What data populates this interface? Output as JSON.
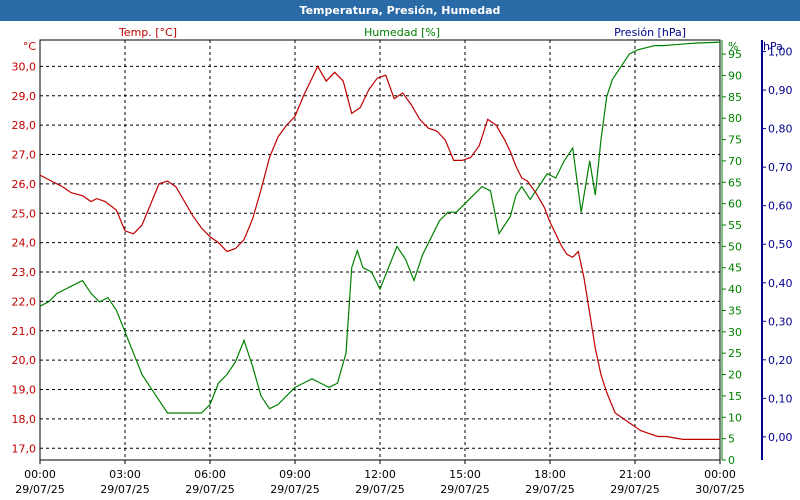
{
  "chart_data": {
    "type": "line",
    "title": "Temperatura, Presión, Humedad",
    "colors": {
      "temperature": "#c00000",
      "humidity": "#008000",
      "pressure": "#00008b",
      "title_bar": "#2a6aa7"
    },
    "series_labels": {
      "temperature": "Temp. [°C]",
      "humidity": "Humedad [%]",
      "pressure": "Presión [hPa]"
    },
    "axes": {
      "left": {
        "unit": "°C",
        "range": [
          16.6,
          30.9
        ],
        "ticks": [
          "17,0",
          "18,0",
          "19,0",
          "20,0",
          "21,0",
          "22,0",
          "23,0",
          "24,0",
          "25,0",
          "26,0",
          "27,0",
          "28,0",
          "29,0",
          "30,0"
        ],
        "tick_values": [
          17,
          18,
          19,
          20,
          21,
          22,
          23,
          24,
          25,
          26,
          27,
          28,
          29,
          30
        ]
      },
      "mid": {
        "unit": "%",
        "range": [
          0,
          98.3
        ],
        "ticks": [
          "0",
          "5",
          "10",
          "15",
          "20",
          "25",
          "30",
          "35",
          "40",
          "45",
          "50",
          "55",
          "60",
          "65",
          "70",
          "75",
          "80",
          "85",
          "90",
          "95"
        ],
        "tick_values": [
          0,
          5,
          10,
          15,
          20,
          25,
          30,
          35,
          40,
          45,
          50,
          55,
          60,
          65,
          70,
          75,
          80,
          85,
          90,
          95
        ]
      },
      "right": {
        "unit": "hPa",
        "range": [
          -0.06,
          1.03
        ],
        "ticks": [
          "0,00",
          "0,10",
          "0,20",
          "0,30",
          "0,40",
          "0,50",
          "0,60",
          "0,70",
          "0,80",
          "0,90",
          "1,00"
        ],
        "tick_values": [
          0,
          0.1,
          0.2,
          0.3,
          0.4,
          0.5,
          0.6,
          0.7,
          0.8,
          0.9,
          1.0
        ]
      },
      "x": {
        "range": [
          0,
          24
        ],
        "ticks": [
          {
            "time": "00:00",
            "date": "29/07/25"
          },
          {
            "time": "03:00",
            "date": "29/07/25"
          },
          {
            "time": "06:00",
            "date": "29/07/25"
          },
          {
            "time": "09:00",
            "date": "29/07/25"
          },
          {
            "time": "12:00",
            "date": "29/07/25"
          },
          {
            "time": "15:00",
            "date": "29/07/25"
          },
          {
            "time": "18:00",
            "date": "29/07/25"
          },
          {
            "time": "21:00",
            "date": "29/07/25"
          },
          {
            "time": "00:00",
            "date": "30/07/25"
          }
        ]
      }
    },
    "grid": true,
    "temperature": {
      "x": [
        0,
        0.4,
        0.8,
        1.1,
        1.5,
        1.8,
        2.0,
        2.3,
        2.7,
        3.0,
        3.3,
        3.6,
        3.9,
        4.2,
        4.5,
        4.8,
        5.1,
        5.4,
        5.7,
        6.0,
        6.3,
        6.6,
        6.9,
        7.2,
        7.5,
        7.8,
        8.1,
        8.4,
        8.7,
        9.0,
        9.3,
        9.6,
        9.8,
        10.1,
        10.4,
        10.7,
        11.0,
        11.3,
        11.6,
        11.9,
        12.2,
        12.5,
        12.8,
        13.1,
        13.4,
        13.7,
        14.0,
        14.3,
        14.6,
        14.9,
        15.2,
        15.5,
        15.8,
        16.1,
        16.4,
        16.6,
        16.8,
        17.0,
        17.2,
        17.5,
        17.8,
        18.0,
        18.2,
        18.4,
        18.6,
        18.8,
        19.0,
        19.2,
        19.4,
        19.6,
        19.8,
        20.0,
        20.3,
        20.6,
        20.9,
        21.2,
        21.5,
        21.8,
        22.1,
        22.4,
        22.7,
        23.0,
        23.3,
        23.6,
        24.0
      ],
      "y": [
        26.3,
        26.1,
        25.9,
        25.7,
        25.6,
        25.4,
        25.5,
        25.4,
        25.1,
        24.4,
        24.3,
        24.6,
        25.3,
        26.0,
        26.1,
        25.9,
        25.4,
        24.9,
        24.5,
        24.2,
        24.0,
        23.7,
        23.8,
        24.1,
        24.8,
        25.8,
        26.9,
        27.6,
        28.0,
        28.3,
        29.0,
        29.6,
        30.0,
        29.5,
        29.8,
        29.5,
        28.4,
        28.6,
        29.2,
        29.6,
        29.7,
        28.9,
        29.1,
        28.7,
        28.2,
        27.9,
        27.8,
        27.5,
        26.8,
        26.8,
        26.9,
        27.3,
        28.2,
        28.0,
        27.5,
        27.1,
        26.6,
        26.2,
        26.1,
        25.7,
        25.2,
        24.7,
        24.3,
        23.9,
        23.6,
        23.5,
        23.7,
        22.8,
        21.6,
        20.4,
        19.5,
        18.9,
        18.2,
        18.0,
        17.8,
        17.6,
        17.5,
        17.4,
        17.4,
        17.35,
        17.3,
        17.3,
        17.3,
        17.3,
        17.3
      ]
    },
    "humidity": {
      "x": [
        0,
        0.3,
        0.6,
        0.9,
        1.2,
        1.5,
        1.8,
        2.1,
        2.4,
        2.7,
        3.0,
        3.3,
        3.6,
        3.9,
        4.2,
        4.5,
        4.8,
        5.1,
        5.4,
        5.7,
        6.0,
        6.3,
        6.6,
        6.9,
        7.2,
        7.5,
        7.8,
        8.1,
        8.4,
        8.7,
        9.0,
        9.3,
        9.6,
        9.9,
        10.2,
        10.5,
        10.8,
        11.0,
        11.2,
        11.4,
        11.7,
        12.0,
        12.3,
        12.6,
        12.9,
        13.2,
        13.5,
        13.8,
        14.1,
        14.4,
        14.7,
        15.0,
        15.3,
        15.6,
        15.9,
        16.2,
        16.4,
        16.6,
        16.8,
        17.0,
        17.3,
        17.6,
        17.9,
        18.2,
        18.5,
        18.8,
        19.1,
        19.4,
        19.6,
        19.8,
        20.0,
        20.2,
        20.5,
        20.8,
        21.1,
        21.4,
        21.7,
        22.0,
        22.4,
        22.8,
        23.2,
        23.6,
        24.0
      ],
      "y": [
        36,
        37,
        39,
        40,
        41,
        42,
        39,
        37,
        38,
        35,
        30,
        25,
        20,
        17,
        14,
        11,
        11,
        11,
        11,
        11,
        13,
        18,
        20,
        23,
        28,
        22,
        15,
        12,
        13,
        15,
        17,
        18,
        19,
        18,
        17,
        18,
        25,
        45,
        49,
        45,
        44,
        40,
        45,
        50,
        47,
        42,
        48,
        52,
        56,
        58,
        58,
        60,
        62,
        64,
        63,
        53,
        55,
        57,
        62,
        64,
        61,
        64,
        67,
        66,
        70,
        73,
        58,
        70,
        62,
        75,
        85,
        89,
        92,
        95,
        96,
        96.5,
        97,
        97,
        97.2,
        97.4,
        97.6,
        97.7,
        97.8
      ]
    }
  }
}
